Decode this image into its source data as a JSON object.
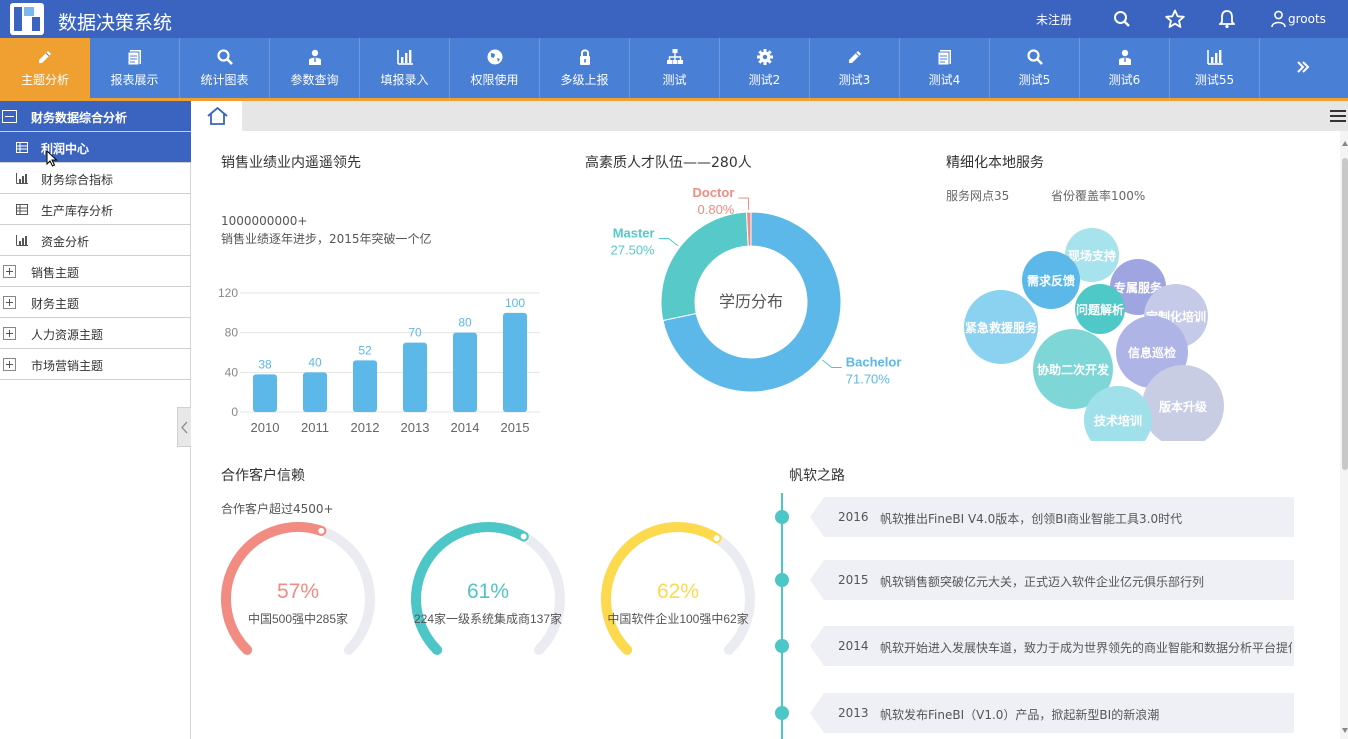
{
  "app": {
    "title": "数据决策系统"
  },
  "topbar": {
    "unregistered": "未注册",
    "user": "groots"
  },
  "nav": [
    {
      "label": "主题分析",
      "icon": "pencil-icon",
      "active": true
    },
    {
      "label": "报表展示",
      "icon": "report-icon"
    },
    {
      "label": "统计图表",
      "icon": "search-icon"
    },
    {
      "label": "参数查询",
      "icon": "user-icon"
    },
    {
      "label": "填报录入",
      "icon": "bar-chart-icon"
    },
    {
      "label": "权限使用",
      "icon": "globe-icon"
    },
    {
      "label": "多级上报",
      "icon": "lock-icon"
    },
    {
      "label": "测试",
      "icon": "hierarchy-icon"
    },
    {
      "label": "测试2",
      "icon": "gear-icon"
    },
    {
      "label": "测试3",
      "icon": "pencil-icon"
    },
    {
      "label": "测试4",
      "icon": "report-icon"
    },
    {
      "label": "测试5",
      "icon": "search-icon"
    },
    {
      "label": "测试6",
      "icon": "user-icon"
    },
    {
      "label": "测试55",
      "icon": "bar-chart-icon"
    }
  ],
  "sidebar": {
    "group": "财务数据综合分析",
    "children": [
      {
        "label": "利润中心",
        "selected": true
      },
      {
        "label": "财务综合指标"
      },
      {
        "label": "生产库存分析"
      },
      {
        "label": "资金分析"
      }
    ],
    "topics": [
      "销售主题",
      "财务主题",
      "人力资源主题",
      "市场营销主题"
    ]
  },
  "sales": {
    "title": "销售业绩业内遥遥领先",
    "line1": "1000000000+",
    "line2": "销售业绩逐年进步，2015年突破一个亿"
  },
  "talent": {
    "title": "高素质人才队伍——280人",
    "center_label": "学历分布"
  },
  "service": {
    "title": "精细化本地服务",
    "stat1": "服务网点35",
    "stat2": "省份覆盖率100%",
    "bubbles": [
      {
        "label": "现场支持",
        "color": "#a6e3ec"
      },
      {
        "label": "需求反馈",
        "color": "#5bb8e8"
      },
      {
        "label": "专属服务",
        "color": "#9ea5e0"
      },
      {
        "label": "问题解析",
        "color": "#4fc8c8"
      },
      {
        "label": "定制化培训",
        "color": "#c5cae8"
      },
      {
        "label": "紧急救援服务",
        "color": "#8ad2f0"
      },
      {
        "label": "信息巡检",
        "color": "#aeb4e6"
      },
      {
        "label": "协助二次开发",
        "color": "#7fd6d6"
      },
      {
        "label": "版本升级",
        "color": "#c8cde4"
      },
      {
        "label": "技术培训",
        "color": "#a0e0ea"
      }
    ]
  },
  "clients": {
    "title": "合作客户信赖",
    "subtitle": "合作客户超过4500+",
    "gauges": [
      {
        "percent": "57%",
        "value": 0.57,
        "label": "中国500强中285家",
        "color": "#f28b82"
      },
      {
        "percent": "61%",
        "value": 0.61,
        "label": "224家一级系统集成商137家",
        "color": "#4cc6c6"
      },
      {
        "percent": "62%",
        "value": 0.62,
        "label": "中国软件企业100强中62家",
        "color": "#fdd94e"
      }
    ]
  },
  "road": {
    "title": "帆软之路",
    "events": [
      {
        "year": "2016",
        "text": "帆软推出FineBI V4.0版本，创领BI商业智能工具3.0时代"
      },
      {
        "year": "2015",
        "text": "帆软销售额突破亿元大关，正式迈入软件企业亿元俱乐部行列"
      },
      {
        "year": "2014",
        "text": "帆软开始进入发展快车道，致力于成为世界领先的商业智能和数据分析平台提供商"
      },
      {
        "year": "2013",
        "text": "帆软发布FineBI（V1.0）产品，掀起新型BI的新浪潮"
      }
    ]
  },
  "chart_data": [
    {
      "type": "bar",
      "categories": [
        "2010",
        "2011",
        "2012",
        "2013",
        "2014",
        "2015"
      ],
      "values": [
        38,
        40,
        52,
        70,
        80,
        100
      ],
      "ylim": [
        0,
        120
      ],
      "yticks": [
        0,
        40,
        80,
        120
      ],
      "color": "#5bb8e8",
      "grid": true
    },
    {
      "type": "pie",
      "slices": [
        {
          "name": "Bachelor",
          "value": 71.7,
          "label": "71.70%",
          "color": "#5bb8e8"
        },
        {
          "name": "Master",
          "value": 27.5,
          "label": "27.50%",
          "color": "#57c9c9"
        },
        {
          "name": "Doctor",
          "value": 0.8,
          "label": "0.80%",
          "color": "#f28b82"
        }
      ]
    }
  ]
}
